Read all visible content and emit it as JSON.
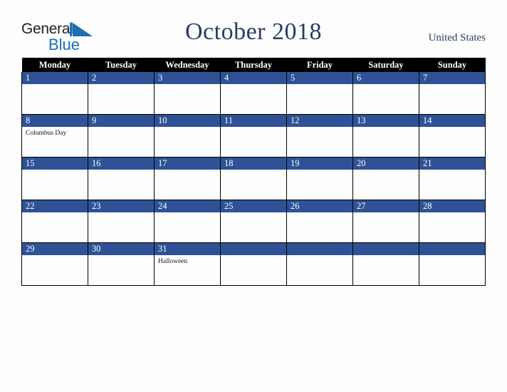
{
  "brand": {
    "name_top": "General",
    "name_bottom": "Blue",
    "mark": "triangle-logo",
    "color_dark": "#231f20",
    "color_blue": "#1b6fb5"
  },
  "header": {
    "title": "October 2018",
    "country": "United States",
    "title_color": "#2c3c63"
  },
  "calendar": {
    "header_bg": "#000000",
    "header_text_color": "#ffffff",
    "daynum_band_bg": "#2e5295",
    "grid_color": "#000000",
    "cell_bg": "#fdfdfd",
    "weekdays": [
      "Monday",
      "Tuesday",
      "Wednesday",
      "Thursday",
      "Friday",
      "Saturday",
      "Sunday"
    ],
    "weeks": [
      [
        {
          "day": "1",
          "events": []
        },
        {
          "day": "2",
          "events": []
        },
        {
          "day": "3",
          "events": []
        },
        {
          "day": "4",
          "events": []
        },
        {
          "day": "5",
          "events": []
        },
        {
          "day": "6",
          "events": []
        },
        {
          "day": "7",
          "events": []
        }
      ],
      [
        {
          "day": "8",
          "events": [
            "Columbus Day"
          ]
        },
        {
          "day": "9",
          "events": []
        },
        {
          "day": "10",
          "events": []
        },
        {
          "day": "11",
          "events": []
        },
        {
          "day": "12",
          "events": []
        },
        {
          "day": "13",
          "events": []
        },
        {
          "day": "14",
          "events": []
        }
      ],
      [
        {
          "day": "15",
          "events": []
        },
        {
          "day": "16",
          "events": []
        },
        {
          "day": "17",
          "events": []
        },
        {
          "day": "18",
          "events": []
        },
        {
          "day": "19",
          "events": []
        },
        {
          "day": "20",
          "events": []
        },
        {
          "day": "21",
          "events": []
        }
      ],
      [
        {
          "day": "22",
          "events": []
        },
        {
          "day": "23",
          "events": []
        },
        {
          "day": "24",
          "events": []
        },
        {
          "day": "25",
          "events": []
        },
        {
          "day": "26",
          "events": []
        },
        {
          "day": "27",
          "events": []
        },
        {
          "day": "28",
          "events": []
        }
      ],
      [
        {
          "day": "29",
          "events": []
        },
        {
          "day": "30",
          "events": []
        },
        {
          "day": "31",
          "events": [
            "Halloween"
          ]
        },
        {
          "day": "",
          "events": []
        },
        {
          "day": "",
          "events": []
        },
        {
          "day": "",
          "events": []
        },
        {
          "day": "",
          "events": []
        }
      ]
    ]
  }
}
